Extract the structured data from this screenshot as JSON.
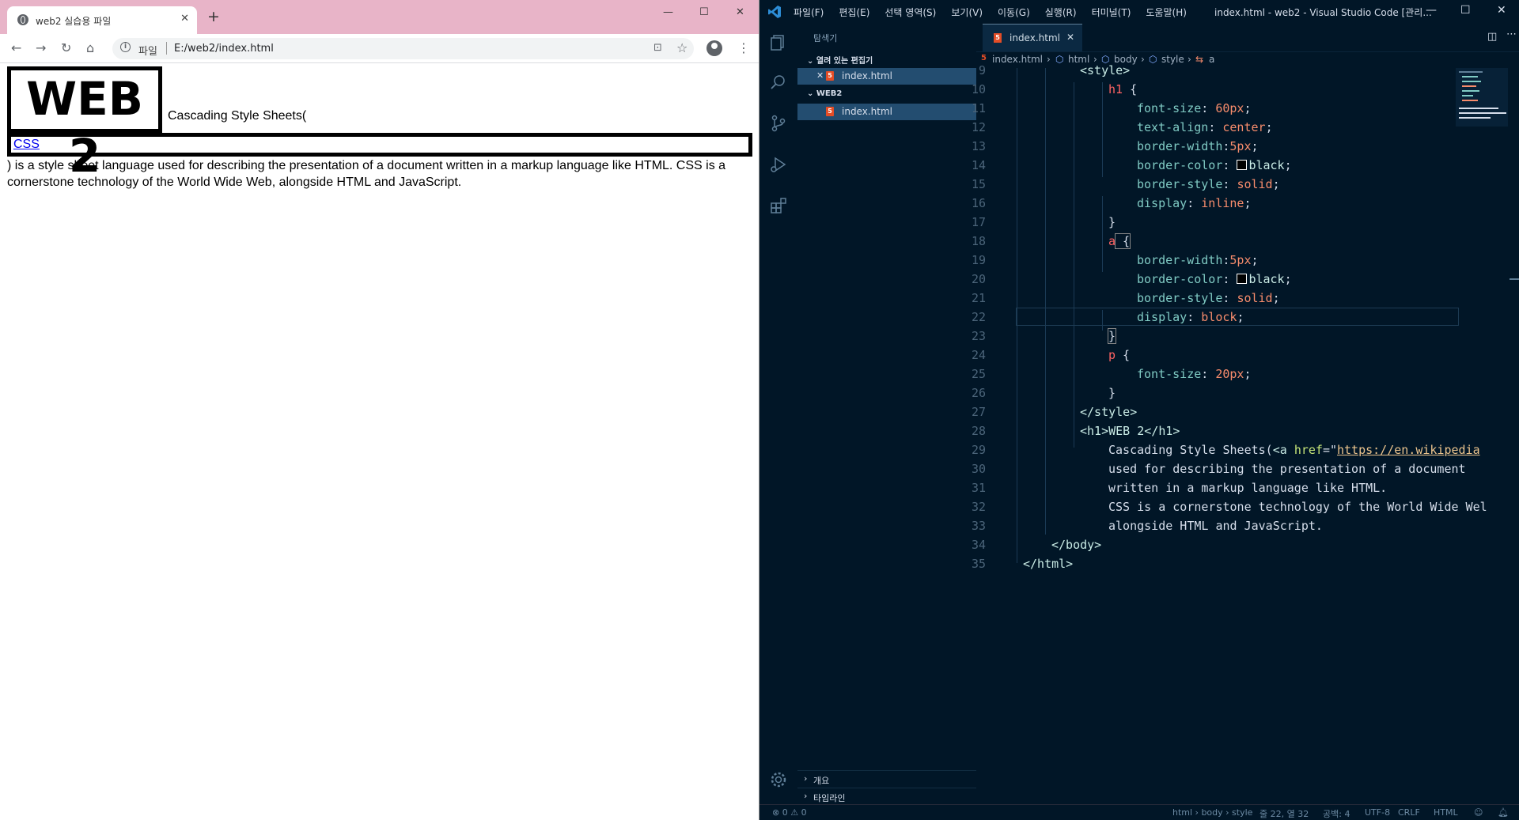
{
  "browser": {
    "tab_title": "web2 실습용 파일",
    "scheme_label": "파일",
    "url": "E:/web2/index.html",
    "page": {
      "h1": "WEB 2",
      "lead": "Cascading Style Sheets(",
      "link_text": "CSS",
      "desc": ") is a style sheet language used for describing the presentation of a document written in a markup language like HTML. CSS is a cornerstone technology of the World Wide Web, alongside HTML and JavaScript."
    }
  },
  "vscode": {
    "menu": [
      "파일(F)",
      "편집(E)",
      "선택 영역(S)",
      "보기(V)",
      "이동(G)",
      "실행(R)",
      "터미널(T)",
      "도움말(H)"
    ],
    "window_title": "index.html - web2 - Visual Studio Code [관리...",
    "explorer_title": "탐색기",
    "open_editors_label": "열려 있는 편집기",
    "workspace_label": "WEB2",
    "file_name": "index.html",
    "outline_label": "개요",
    "timeline_label": "타임라인",
    "tab_name": "index.html",
    "breadcrumb": [
      "index.html",
      "html",
      "body",
      "style",
      "a"
    ],
    "line_numbers": [
      "9",
      "10",
      "11",
      "12",
      "13",
      "14",
      "15",
      "16",
      "17",
      "18",
      "19",
      "20",
      "21",
      "22",
      "23",
      "24",
      "25",
      "26",
      "27",
      "28",
      "29",
      "30",
      "31",
      "32",
      "33",
      "34",
      "35"
    ],
    "code": {
      "l9": "<style>",
      "l10_sel": "h1",
      "l10_brace": " {",
      "l11_prop": "font-size",
      "l11_val": "60px",
      "l12_prop": "text-align",
      "l12_val": "center",
      "l13_prop": "border-width",
      "l13_val": "5px",
      "l14_prop": "border-color",
      "l14_val": "black",
      "l15_prop": "border-style",
      "l15_val": "solid",
      "l16_prop": "display",
      "l16_val": "inline",
      "l17": "}",
      "l18_sel": "a",
      "l18_brace": " {",
      "l19_prop": "border-width",
      "l19_val": "5px",
      "l20_prop": "border-color",
      "l20_val": "black",
      "l21_prop": "border-style",
      "l21_val": "solid",
      "l22_prop": "display",
      "l22_val": "block",
      "l23": "}",
      "l24_sel": "p",
      "l24_brace": " {",
      "l25_prop": "font-size",
      "l25_val": "20px",
      "l26": "}",
      "l27": "</style>",
      "l28": "<h1>WEB 2</h1>",
      "l29_text": "Cascading Style Sheets(",
      "l29_tag": "<a ",
      "l29_attr": "href",
      "l29_eq": "=\"",
      "l29_str": "https://en.wikipedia",
      "l30": "used for describing the presentation of a document",
      "l31": "written in a markup language like HTML.",
      "l32": "CSS is a cornerstone technology of the World Wide Wel",
      "l33": "alongside HTML and JavaScript.",
      "l34": "</body>",
      "l35": "</html>"
    },
    "status": {
      "problems": "⊗ 0 ⚠ 0",
      "path": "html › body › style",
      "position": "줄 22, 열 32",
      "spaces": "공백: 4",
      "encoding": "UTF-8",
      "eol": "CRLF",
      "language": "HTML"
    },
    "colors": {
      "bg": "#011627",
      "selector": "#ff6363",
      "property": "#80cbc4",
      "value": "#f78c6c"
    }
  }
}
